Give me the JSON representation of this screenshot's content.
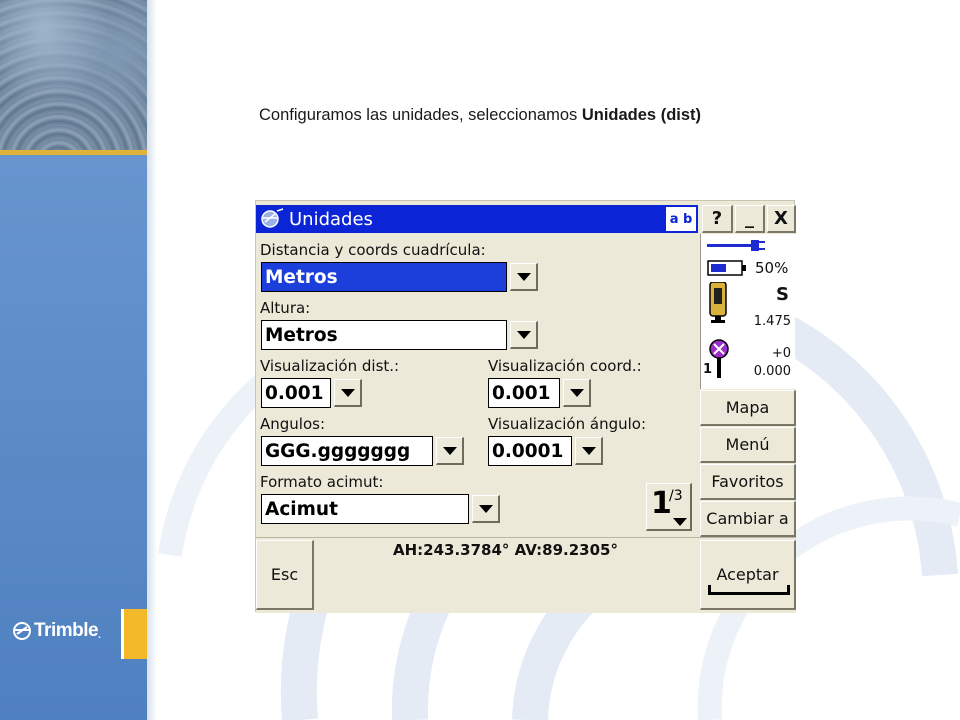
{
  "slide": {
    "caption_prefix": "Configuramos las unidades, seleccionamos ",
    "caption_bold": "Unidades (dist)",
    "logo_text": "Trimble",
    "logo_suffix": ".",
    "colors": {
      "band": "#5d8cc8",
      "accent": "#f3b92a",
      "titlebar": "#0a24d6"
    }
  },
  "window": {
    "title": "Unidades",
    "ab_button": "a b",
    "help_button": "?",
    "minimize_button": "_",
    "close_button": "X"
  },
  "form": {
    "distance_label": "Distancia y coords cuadrícula:",
    "distance_value": "Metros",
    "height_label": "Altura:",
    "height_value": "Metros",
    "dist_display_label": "Visualización dist.:",
    "dist_display_value": "0.001",
    "coord_display_label": "Visualización coord.:",
    "coord_display_value": "0.001",
    "angles_label": "Angulos:",
    "angles_value": "GGG.ggggggg",
    "angle_display_label": "Visualización ángulo:",
    "angle_display_value": "0.0001",
    "azimuth_label": "Formato acimut:",
    "azimuth_value": "Acimut",
    "page_current": "1",
    "page_total": "/3"
  },
  "status": {
    "battery": "50%",
    "instrument_mode": "S",
    "instrument_height": "1.475",
    "prism_offset": "+0",
    "prism_height": "0.000",
    "prism_index": "1"
  },
  "sidebar": {
    "items": [
      {
        "label": "Mapa"
      },
      {
        "label": "Menú"
      },
      {
        "label": "Favoritos"
      },
      {
        "label": "Cambiar a"
      }
    ]
  },
  "bottom": {
    "esc_label": "Esc",
    "readout": "AH:243.3784°  AV:89.2305°",
    "accept_label": "Aceptar"
  }
}
